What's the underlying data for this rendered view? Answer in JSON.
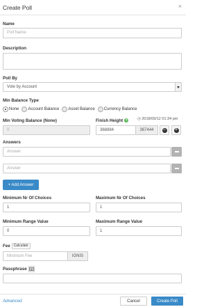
{
  "modal": {
    "title": "Create Poll",
    "close_glyph": "×"
  },
  "name": {
    "label": "Name",
    "placeholder": "Poll Name",
    "value": ""
  },
  "description": {
    "label": "Description",
    "value": ""
  },
  "poll_by": {
    "label": "Poll By",
    "selected": "Vote by Account"
  },
  "min_balance_type": {
    "label": "Min Balance Type",
    "options": [
      "None",
      "Account Balance",
      "Asset Balance",
      "Currency Balance"
    ],
    "selected": "None"
  },
  "min_voting_balance": {
    "label": "Min Voting Balance (None)",
    "value": "0"
  },
  "finish_height": {
    "label": "Finish Height",
    "help_glyph": "?",
    "clock_glyph": "◷",
    "timestamp": "2018/09/12 01:34 pm",
    "value": "368884",
    "current_height": "367444",
    "minus_glyph": "−",
    "plus_glyph": "+"
  },
  "answers": {
    "label": "Answers",
    "items": [
      {
        "placeholder": "Answer",
        "value": ""
      },
      {
        "placeholder": "Answer",
        "value": ""
      }
    ],
    "add_label": "+ Add Answer"
  },
  "min_choices": {
    "label": "Minimum Nr Of Choices",
    "value": "1"
  },
  "max_choices": {
    "label": "Maximum Nr Of Choices",
    "value": "1"
  },
  "min_range": {
    "label": "Minimum Range Value",
    "value": "0"
  },
  "max_range": {
    "label": "Maximum Range Value",
    "value": "1"
  },
  "fee": {
    "label": "Fee",
    "calculate_label": "Calculate",
    "placeholder": "Minimum Fee",
    "unit": "IGNIS",
    "value": ""
  },
  "passphrase": {
    "label": "Passphrase",
    "value": ""
  },
  "footer": {
    "advanced_label": "Advanced",
    "cancel_label": "Cancel",
    "submit_label": "Create Poll"
  },
  "colors": {
    "primary": "#3a8ac8",
    "help": "#5cb85c",
    "border": "#cccccc"
  },
  "icons": {
    "close": "close-icon",
    "help": "help-icon",
    "clock": "clock-icon",
    "passphrase": "keyboard-icon"
  }
}
